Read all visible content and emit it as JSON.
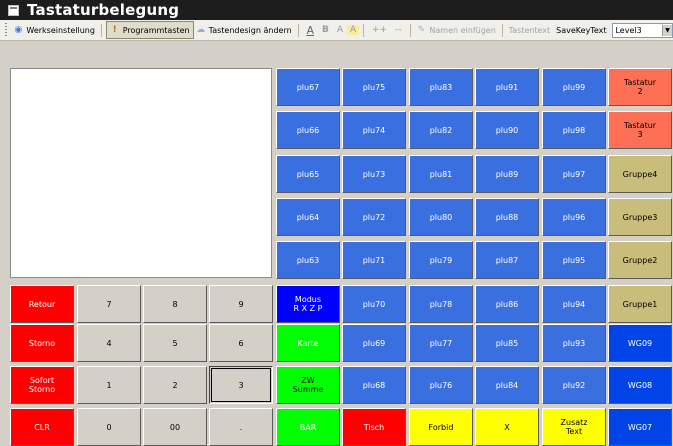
{
  "window": {
    "title": "Tastaturbelegung"
  },
  "toolbar": {
    "werkseinstellung": "Werkseinstellung",
    "programmtasten": "Programmtasten",
    "tastendesign": "Tastendesign ändern",
    "font_a_under": "A",
    "font_b": "B",
    "font_a_small": "A",
    "font_a_hl": "A",
    "plus": "++",
    "minus": "--",
    "namen_einfuegen": "Namen einfügen",
    "tastentext": "Tastentext",
    "savekeytext": "SaveKeyText",
    "level_value": "Level3"
  },
  "colors": {
    "plu_blue": "#3a6fe0",
    "red": "#ff0000",
    "gray": "#d4d0c8",
    "salmon": "#fd7055",
    "olive": "#c9bd7c",
    "wg_blue": "#0044e8",
    "modus_blue": "#0000ff",
    "green": "#00ff00",
    "yellow": "#ffff00"
  },
  "keys": [
    {
      "label": "plu67",
      "row": 0,
      "col": 4,
      "color": "plu_blue",
      "text": "#ffffff"
    },
    {
      "label": "plu75",
      "row": 0,
      "col": 5,
      "color": "plu_blue",
      "text": "#ffffff"
    },
    {
      "label": "plu83",
      "row": 0,
      "col": 6,
      "color": "plu_blue",
      "text": "#ffffff"
    },
    {
      "label": "plu91",
      "row": 0,
      "col": 7,
      "color": "plu_blue",
      "text": "#ffffff"
    },
    {
      "label": "plu99",
      "row": 0,
      "col": 8,
      "color": "plu_blue",
      "text": "#ffffff"
    },
    {
      "label": "Tastatur\n2",
      "row": 0,
      "col": 9,
      "color": "salmon",
      "text": "#000000"
    },
    {
      "label": "plu66",
      "row": 1,
      "col": 4,
      "color": "plu_blue",
      "text": "#ffffff"
    },
    {
      "label": "plu74",
      "row": 1,
      "col": 5,
      "color": "plu_blue",
      "text": "#ffffff"
    },
    {
      "label": "plu82",
      "row": 1,
      "col": 6,
      "color": "plu_blue",
      "text": "#ffffff"
    },
    {
      "label": "plu90",
      "row": 1,
      "col": 7,
      "color": "plu_blue",
      "text": "#ffffff"
    },
    {
      "label": "plu98",
      "row": 1,
      "col": 8,
      "color": "plu_blue",
      "text": "#ffffff"
    },
    {
      "label": "Tastatur\n3",
      "row": 1,
      "col": 9,
      "color": "salmon",
      "text": "#000000"
    },
    {
      "label": "plu65",
      "row": 2,
      "col": 4,
      "color": "plu_blue",
      "text": "#ffffff"
    },
    {
      "label": "plu73",
      "row": 2,
      "col": 5,
      "color": "plu_blue",
      "text": "#ffffff"
    },
    {
      "label": "plu81",
      "row": 2,
      "col": 6,
      "color": "plu_blue",
      "text": "#ffffff"
    },
    {
      "label": "plu89",
      "row": 2,
      "col": 7,
      "color": "plu_blue",
      "text": "#ffffff"
    },
    {
      "label": "plu97",
      "row": 2,
      "col": 8,
      "color": "plu_blue",
      "text": "#ffffff"
    },
    {
      "label": "Gruppe4",
      "row": 2,
      "col": 9,
      "color": "olive",
      "text": "#000000"
    },
    {
      "label": "plu64",
      "row": 3,
      "col": 4,
      "color": "plu_blue",
      "text": "#ffffff"
    },
    {
      "label": "plu72",
      "row": 3,
      "col": 5,
      "color": "plu_blue",
      "text": "#ffffff"
    },
    {
      "label": "plu80",
      "row": 3,
      "col": 6,
      "color": "plu_blue",
      "text": "#ffffff"
    },
    {
      "label": "plu88",
      "row": 3,
      "col": 7,
      "color": "plu_blue",
      "text": "#ffffff"
    },
    {
      "label": "plu96",
      "row": 3,
      "col": 8,
      "color": "plu_blue",
      "text": "#ffffff"
    },
    {
      "label": "Gruppe3",
      "row": 3,
      "col": 9,
      "color": "olive",
      "text": "#000000"
    },
    {
      "label": "plu63",
      "row": 4,
      "col": 4,
      "color": "plu_blue",
      "text": "#ffffff"
    },
    {
      "label": "plu71",
      "row": 4,
      "col": 5,
      "color": "plu_blue",
      "text": "#ffffff"
    },
    {
      "label": "plu79",
      "row": 4,
      "col": 6,
      "color": "plu_blue",
      "text": "#ffffff"
    },
    {
      "label": "plu87",
      "row": 4,
      "col": 7,
      "color": "plu_blue",
      "text": "#ffffff"
    },
    {
      "label": "plu95",
      "row": 4,
      "col": 8,
      "color": "plu_blue",
      "text": "#ffffff"
    },
    {
      "label": "Gruppe2",
      "row": 4,
      "col": 9,
      "color": "olive",
      "text": "#000000"
    },
    {
      "label": "Retour",
      "row": 5,
      "col": 0,
      "color": "red",
      "text": "#ffffff"
    },
    {
      "label": "7",
      "row": 5,
      "col": 1,
      "color": "gray",
      "text": "#000000"
    },
    {
      "label": "8",
      "row": 5,
      "col": 2,
      "color": "gray",
      "text": "#000000"
    },
    {
      "label": "9",
      "row": 5,
      "col": 3,
      "color": "gray",
      "text": "#000000"
    },
    {
      "label": "Modus\nR X Z P",
      "row": 5,
      "col": 4,
      "color": "modus_blue",
      "text": "#ffffff"
    },
    {
      "label": "plu70",
      "row": 5,
      "col": 5,
      "color": "plu_blue",
      "text": "#ffffff"
    },
    {
      "label": "plu78",
      "row": 5,
      "col": 6,
      "color": "plu_blue",
      "text": "#ffffff"
    },
    {
      "label": "plu86",
      "row": 5,
      "col": 7,
      "color": "plu_blue",
      "text": "#ffffff"
    },
    {
      "label": "plu94",
      "row": 5,
      "col": 8,
      "color": "plu_blue",
      "text": "#ffffff"
    },
    {
      "label": "Gruppe1",
      "row": 5,
      "col": 9,
      "color": "olive",
      "text": "#000000"
    },
    {
      "label": "Storno",
      "row": 6,
      "col": 0,
      "color": "red",
      "text": "#ffffff"
    },
    {
      "label": "4",
      "row": 6,
      "col": 1,
      "color": "gray",
      "text": "#000000"
    },
    {
      "label": "5",
      "row": 6,
      "col": 2,
      "color": "gray",
      "text": "#000000"
    },
    {
      "label": "6",
      "row": 6,
      "col": 3,
      "color": "gray",
      "text": "#000000"
    },
    {
      "label": "Karte",
      "row": 6,
      "col": 4,
      "color": "green",
      "text": "#ffffff"
    },
    {
      "label": "plu69",
      "row": 6,
      "col": 5,
      "color": "plu_blue",
      "text": "#ffffff"
    },
    {
      "label": "plu77",
      "row": 6,
      "col": 6,
      "color": "plu_blue",
      "text": "#ffffff"
    },
    {
      "label": "plu85",
      "row": 6,
      "col": 7,
      "color": "plu_blue",
      "text": "#ffffff"
    },
    {
      "label": "plu93",
      "row": 6,
      "col": 8,
      "color": "plu_blue",
      "text": "#ffffff"
    },
    {
      "label": "WG09",
      "row": 6,
      "col": 9,
      "color": "wg_blue",
      "text": "#ffffff"
    },
    {
      "label": "Sofort\nStorno",
      "row": 7,
      "col": 0,
      "color": "red",
      "text": "#ffffff"
    },
    {
      "label": "1",
      "row": 7,
      "col": 1,
      "color": "gray",
      "text": "#000000"
    },
    {
      "label": "2",
      "row": 7,
      "col": 2,
      "color": "gray",
      "text": "#000000"
    },
    {
      "label": "3",
      "row": 7,
      "col": 3,
      "color": "gray",
      "text": "#000000",
      "sunken": true
    },
    {
      "label": "ZW\nSumme",
      "row": 7,
      "col": 4,
      "color": "green",
      "text": "#000000"
    },
    {
      "label": "plu68",
      "row": 7,
      "col": 5,
      "color": "plu_blue",
      "text": "#ffffff"
    },
    {
      "label": "plu76",
      "row": 7,
      "col": 6,
      "color": "plu_blue",
      "text": "#ffffff"
    },
    {
      "label": "plu84",
      "row": 7,
      "col": 7,
      "color": "plu_blue",
      "text": "#ffffff"
    },
    {
      "label": "plu92",
      "row": 7,
      "col": 8,
      "color": "plu_blue",
      "text": "#ffffff"
    },
    {
      "label": "WG08",
      "row": 7,
      "col": 9,
      "color": "wg_blue",
      "text": "#ffffff"
    },
    {
      "label": "CLR",
      "row": 8,
      "col": 0,
      "color": "red",
      "text": "#ffffff"
    },
    {
      "label": "0",
      "row": 8,
      "col": 1,
      "color": "gray",
      "text": "#000000"
    },
    {
      "label": "00",
      "row": 8,
      "col": 2,
      "color": "gray",
      "text": "#000000"
    },
    {
      "label": ".",
      "row": 8,
      "col": 3,
      "color": "gray",
      "text": "#000000"
    },
    {
      "label": "BAR",
      "row": 8,
      "col": 4,
      "color": "green",
      "text": "#ffffff"
    },
    {
      "label": "Tisch",
      "row": 8,
      "col": 5,
      "color": "red",
      "text": "#ffffff"
    },
    {
      "label": "Forbid",
      "row": 8,
      "col": 6,
      "color": "yellow",
      "text": "#000000"
    },
    {
      "label": "X",
      "row": 8,
      "col": 7,
      "color": "yellow",
      "text": "#000000"
    },
    {
      "label": "Zusatz\nText",
      "row": 8,
      "col": 8,
      "color": "yellow",
      "text": "#000000"
    },
    {
      "label": "WG07",
      "row": 8,
      "col": 9,
      "color": "wg_blue",
      "text": "#ffffff"
    }
  ]
}
